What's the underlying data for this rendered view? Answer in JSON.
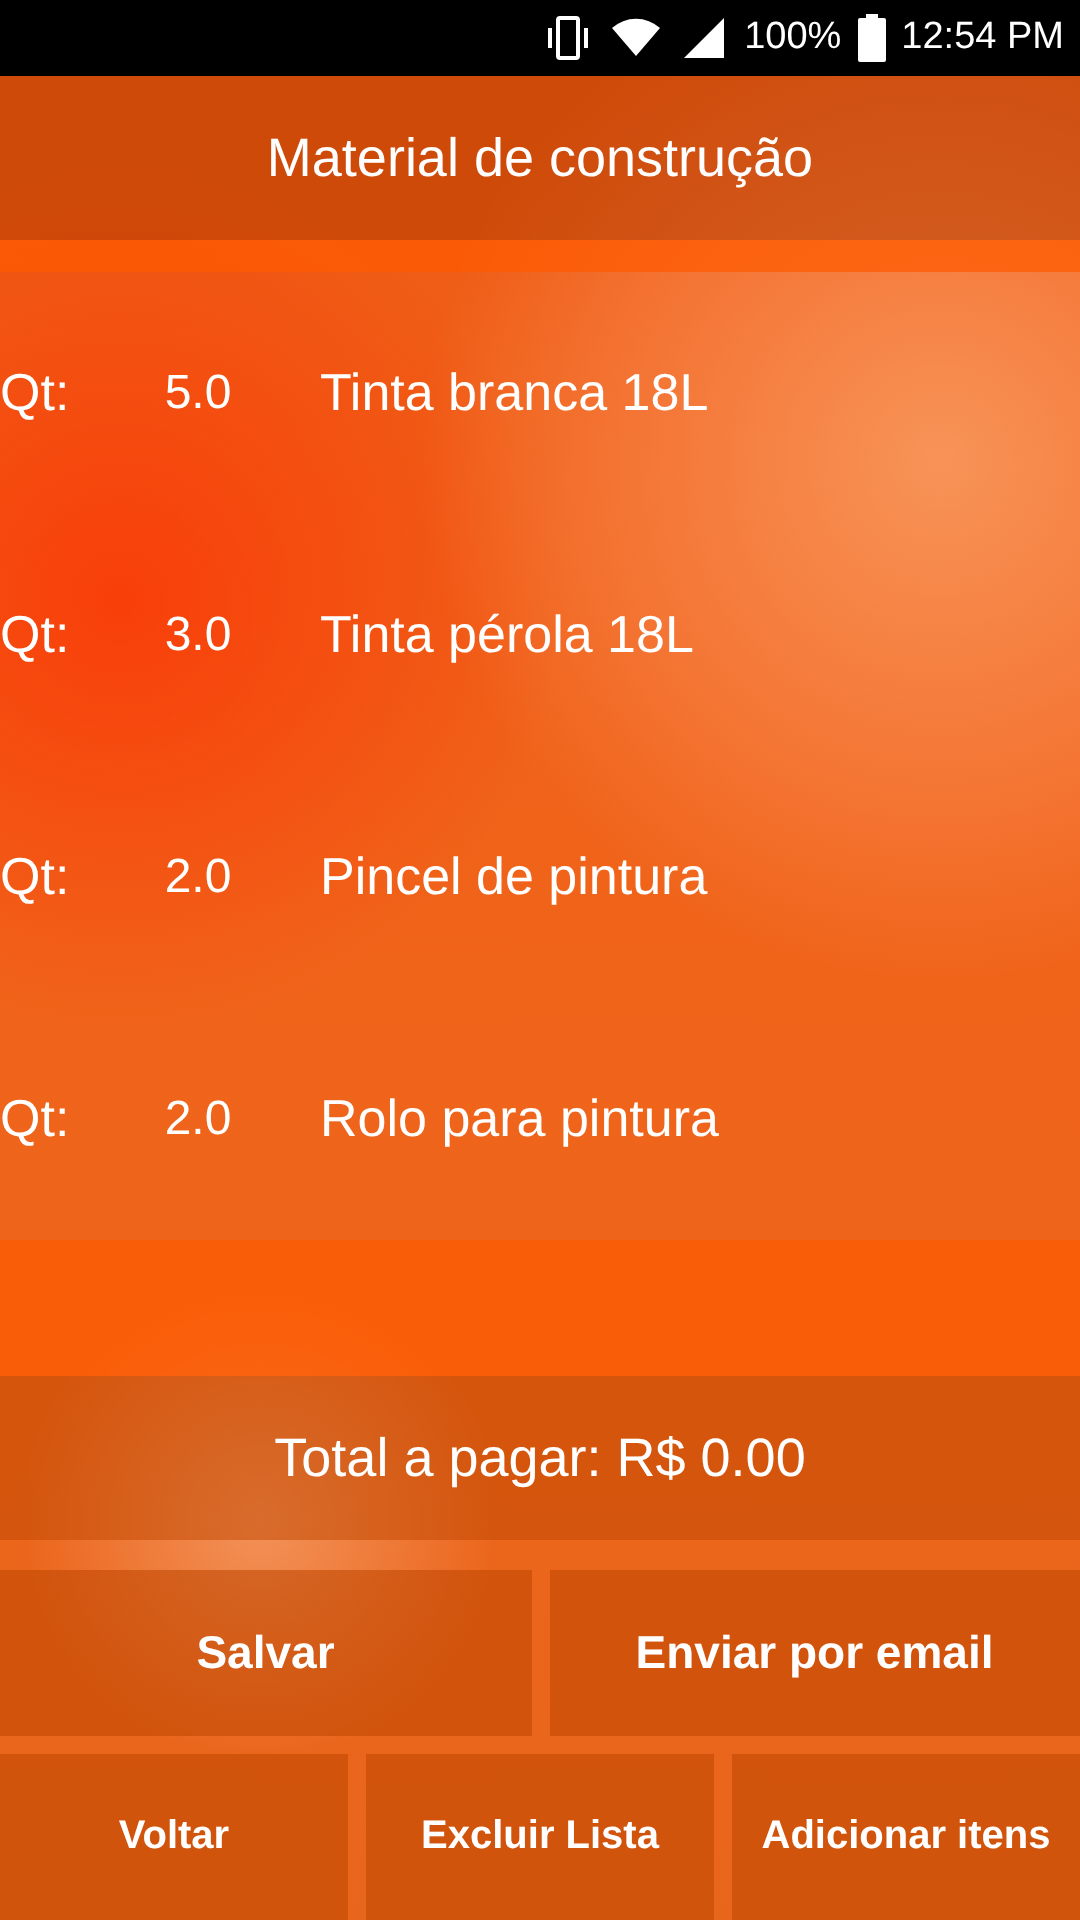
{
  "status_bar": {
    "battery": "100%",
    "time": "12:54 PM"
  },
  "title": "Material de construção",
  "items": [
    {
      "label": "Qt:",
      "quantity": "5.0",
      "name": "Tinta branca 18L"
    },
    {
      "label": "Qt:",
      "quantity": "3.0",
      "name": "Tinta pérola 18L"
    },
    {
      "label": "Qt:",
      "quantity": "2.0",
      "name": "Pincel de pintura"
    },
    {
      "label": "Qt:",
      "quantity": "2.0",
      "name": "Rolo para pintura"
    }
  ],
  "total": "Total a pagar: R$ 0.00",
  "buttons_row_1": [
    "Salvar",
    "Enviar por email"
  ],
  "buttons_row_2": [
    "Voltar",
    "Excluir Lista",
    "Adicionar itens"
  ]
}
